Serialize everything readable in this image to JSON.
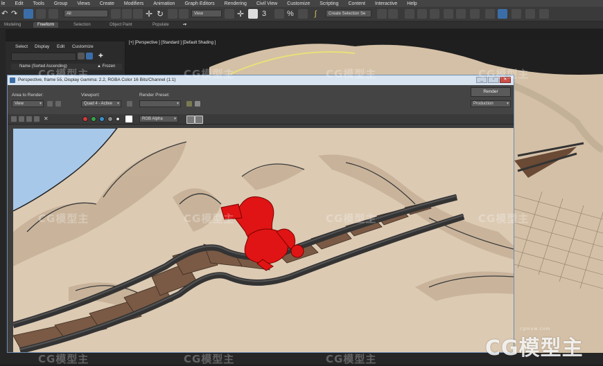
{
  "menu": [
    "le",
    "Edit",
    "Tools",
    "Group",
    "Views",
    "Create",
    "Modifiers",
    "Animation",
    "Graph Editors",
    "Rendering",
    "Civil View",
    "Customize",
    "Scripting",
    "Content",
    "Interactive",
    "Help"
  ],
  "toolbar": {
    "selection_filter": "All",
    "reference_coord": "View",
    "named_selection": "Create Selection Se"
  },
  "ribbon": {
    "tabs": [
      "Modeling",
      "Freeform",
      "Selection",
      "Object Paint",
      "Populate"
    ],
    "active": "Freeform"
  },
  "explorer": {
    "menu": [
      "Select",
      "Display",
      "Edit",
      "Customize"
    ],
    "column_name": "Name (Sorted Ascending)",
    "column_frozen": "▲ Frozen"
  },
  "viewport": {
    "label": "[+] [Perspective ] [Standard ] [Default Shading ]"
  },
  "render_window": {
    "title": "Perspective, frame 55, Display Gamma: 2.2, RGBA Color 16 Bits/Channel (1:1)",
    "area_label": "Area to Render:",
    "area_value": "View",
    "viewport_label": "Viewport:",
    "viewport_value": "Quad 4 - Active",
    "preset_label": "Render Preset:",
    "preset_value": "",
    "render_button": "Render",
    "mode_value": "Production",
    "channel_value": "RGB Alpha",
    "controls": {
      "minimize": "_",
      "maximize": "▫",
      "close": "✕"
    }
  },
  "watermarks": {
    "brand": "CG模型主",
    "site": "cgmxw.com"
  },
  "colors": {
    "accent": "#3b6ea8",
    "window_border": "#6a8bb2",
    "terrain": "#d9c8b1",
    "track_rail": "#3c3c3c",
    "plank": "#7a5a45",
    "figure": "#e01414",
    "water": "#a7c8e8"
  },
  "icons": [
    "undo-icon",
    "redo-icon",
    "link-icon",
    "unlink-icon",
    "select-icon",
    "move-icon",
    "rotate-icon",
    "scale-icon",
    "snap-icon",
    "mirror-icon",
    "align-icon",
    "render-setup-icon",
    "render-icon",
    "save-icon",
    "copy-icon",
    "clone-icon",
    "print-icon",
    "clear-icon",
    "color-channel-icon",
    "filter-icon"
  ]
}
